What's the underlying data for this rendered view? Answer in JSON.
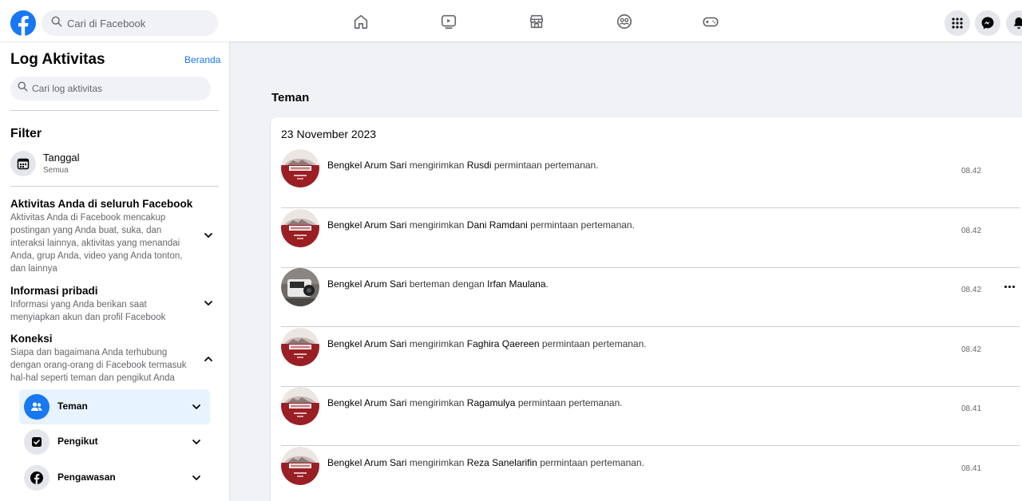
{
  "header": {
    "search_placeholder": "Cari di Facebook",
    "nav": [
      "home-icon",
      "video-icon",
      "marketplace-icon",
      "groups-icon",
      "gaming-icon"
    ],
    "right_buttons": [
      "menu-grid-icon",
      "messenger-icon",
      "notifications-icon"
    ],
    "accent_color": "#1877f2",
    "top_strip_color": "#6b3fa0"
  },
  "sidebar": {
    "title": "Log Aktivitas",
    "home_link": "Beranda",
    "search_placeholder": "Cari log aktivitas",
    "filter_heading": "Filter",
    "date_filter": {
      "label": "Tanggal",
      "value": "Semua"
    },
    "sections": [
      {
        "title": "Aktivitas Anda di seluruh Facebook",
        "description": "Aktivitas Anda di Facebook mencakup postingan yang Anda buat, suka, dan interaksi lainnya, aktivitas yang menandai Anda, grup Anda, video yang Anda tonton, dan lainnya",
        "expanded": false
      },
      {
        "title": "Informasi pribadi",
        "description": "Informasi yang Anda berikan saat menyiapkan akun dan profil Facebook",
        "expanded": false
      },
      {
        "title": "Koneksi",
        "description": "Siapa dan bagaimana Anda terhubung dengan orang-orang di Facebook termasuk hal-hal seperti teman dan pengikut Anda",
        "expanded": true
      }
    ],
    "sub_items": [
      {
        "label": "Teman",
        "icon": "friends-icon",
        "active": true
      },
      {
        "label": "Pengikut",
        "icon": "follower-icon",
        "active": false
      },
      {
        "label": "Pengawasan",
        "icon": "facebook-icon",
        "active": false
      }
    ]
  },
  "main": {
    "heading": "Teman",
    "date": "23 November 2023",
    "entries": [
      {
        "actor": "Bengkel Arum Sari",
        "verb": "mengirimkan",
        "target": "Rusdi",
        "suffix": "permintaan pertemanan.",
        "time": "08.42",
        "avatar": "bengkel",
        "show_more": false
      },
      {
        "actor": "Bengkel Arum Sari",
        "verb": "mengirimkan",
        "target": "Dani Ramdani",
        "suffix": "permintaan pertemanan.",
        "time": "08.42",
        "avatar": "bengkel",
        "show_more": false
      },
      {
        "actor": "Bengkel Arum Sari",
        "verb": "berteman dengan",
        "target": "Irfan Maulana",
        "suffix": ".",
        "time": "08.42",
        "avatar": "car",
        "show_more": true
      },
      {
        "actor": "Bengkel Arum Sari",
        "verb": "mengirimkan",
        "target": "Faghira Qaereen",
        "suffix": "permintaan pertemanan.",
        "time": "08.42",
        "avatar": "bengkel",
        "show_more": false
      },
      {
        "actor": "Bengkel Arum Sari",
        "verb": "mengirimkan",
        "target": "Ragamulya",
        "suffix": "permintaan pertemanan.",
        "time": "08.41",
        "avatar": "bengkel",
        "show_more": false
      },
      {
        "actor": "Bengkel Arum Sari",
        "verb": "mengirimkan",
        "target": "Reza Sanelarifin",
        "suffix": "permintaan pertemanan.",
        "time": "08.41",
        "avatar": "bengkel",
        "show_more": false
      }
    ]
  }
}
